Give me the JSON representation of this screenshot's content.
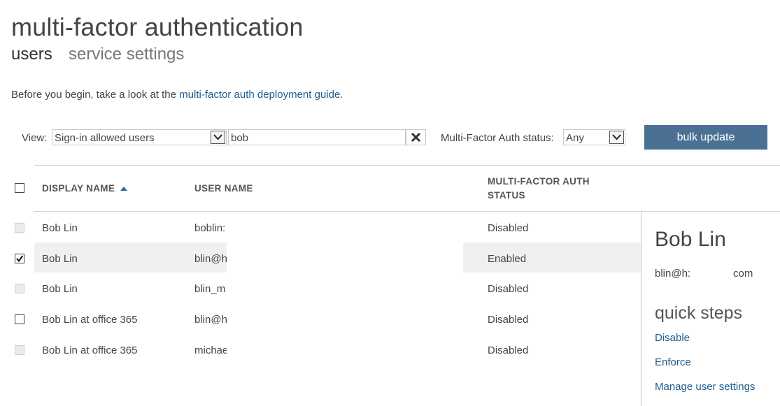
{
  "page": {
    "title": "multi-factor authentication",
    "tabs": [
      "users",
      "service settings"
    ],
    "intro_text": "Before you begin, take a look at the ",
    "intro_link": "multi-factor auth deployment guide."
  },
  "filters": {
    "view_label": "View:",
    "view_value": "Sign-in allowed users",
    "search_value": "bob",
    "mfa_status_label": "Multi-Factor Auth status:",
    "mfa_status_value": "Any",
    "bulk_update_label": "bulk update"
  },
  "table": {
    "columns": [
      "DISPLAY NAME",
      "USER NAME",
      "MULTI-FACTOR AUTH",
      "STATUS"
    ],
    "sort_column": "DISPLAY NAME",
    "rows": [
      {
        "display_name": "Bob Lin",
        "user_name": "boblin:",
        "status": "Disabled",
        "checkbox": "disabled"
      },
      {
        "display_name": "Bob Lin",
        "user_name": "blin@h",
        "status": "Enabled",
        "checkbox": "checked"
      },
      {
        "display_name": "Bob Lin",
        "user_name": "blin_m",
        "status": "Disabled",
        "checkbox": "disabled"
      },
      {
        "display_name": "Bob Lin at office 365",
        "user_name": "blin@h",
        "status": "Disabled",
        "checkbox": "empty"
      },
      {
        "display_name": "Bob Lin at office 365",
        "user_name": "michae",
        "status": "Disabled",
        "checkbox": "disabled"
      }
    ]
  },
  "detail": {
    "name": "Bob Lin",
    "email_start": "blin@h:",
    "email_end": "com",
    "quick_steps_title": "quick steps",
    "quick_steps": [
      "Disable",
      "Enforce",
      "Manage user settings"
    ]
  },
  "colors": {
    "link": "#1e5b8c",
    "button": "#4a7194",
    "row_highlight": "#eef1f0"
  }
}
